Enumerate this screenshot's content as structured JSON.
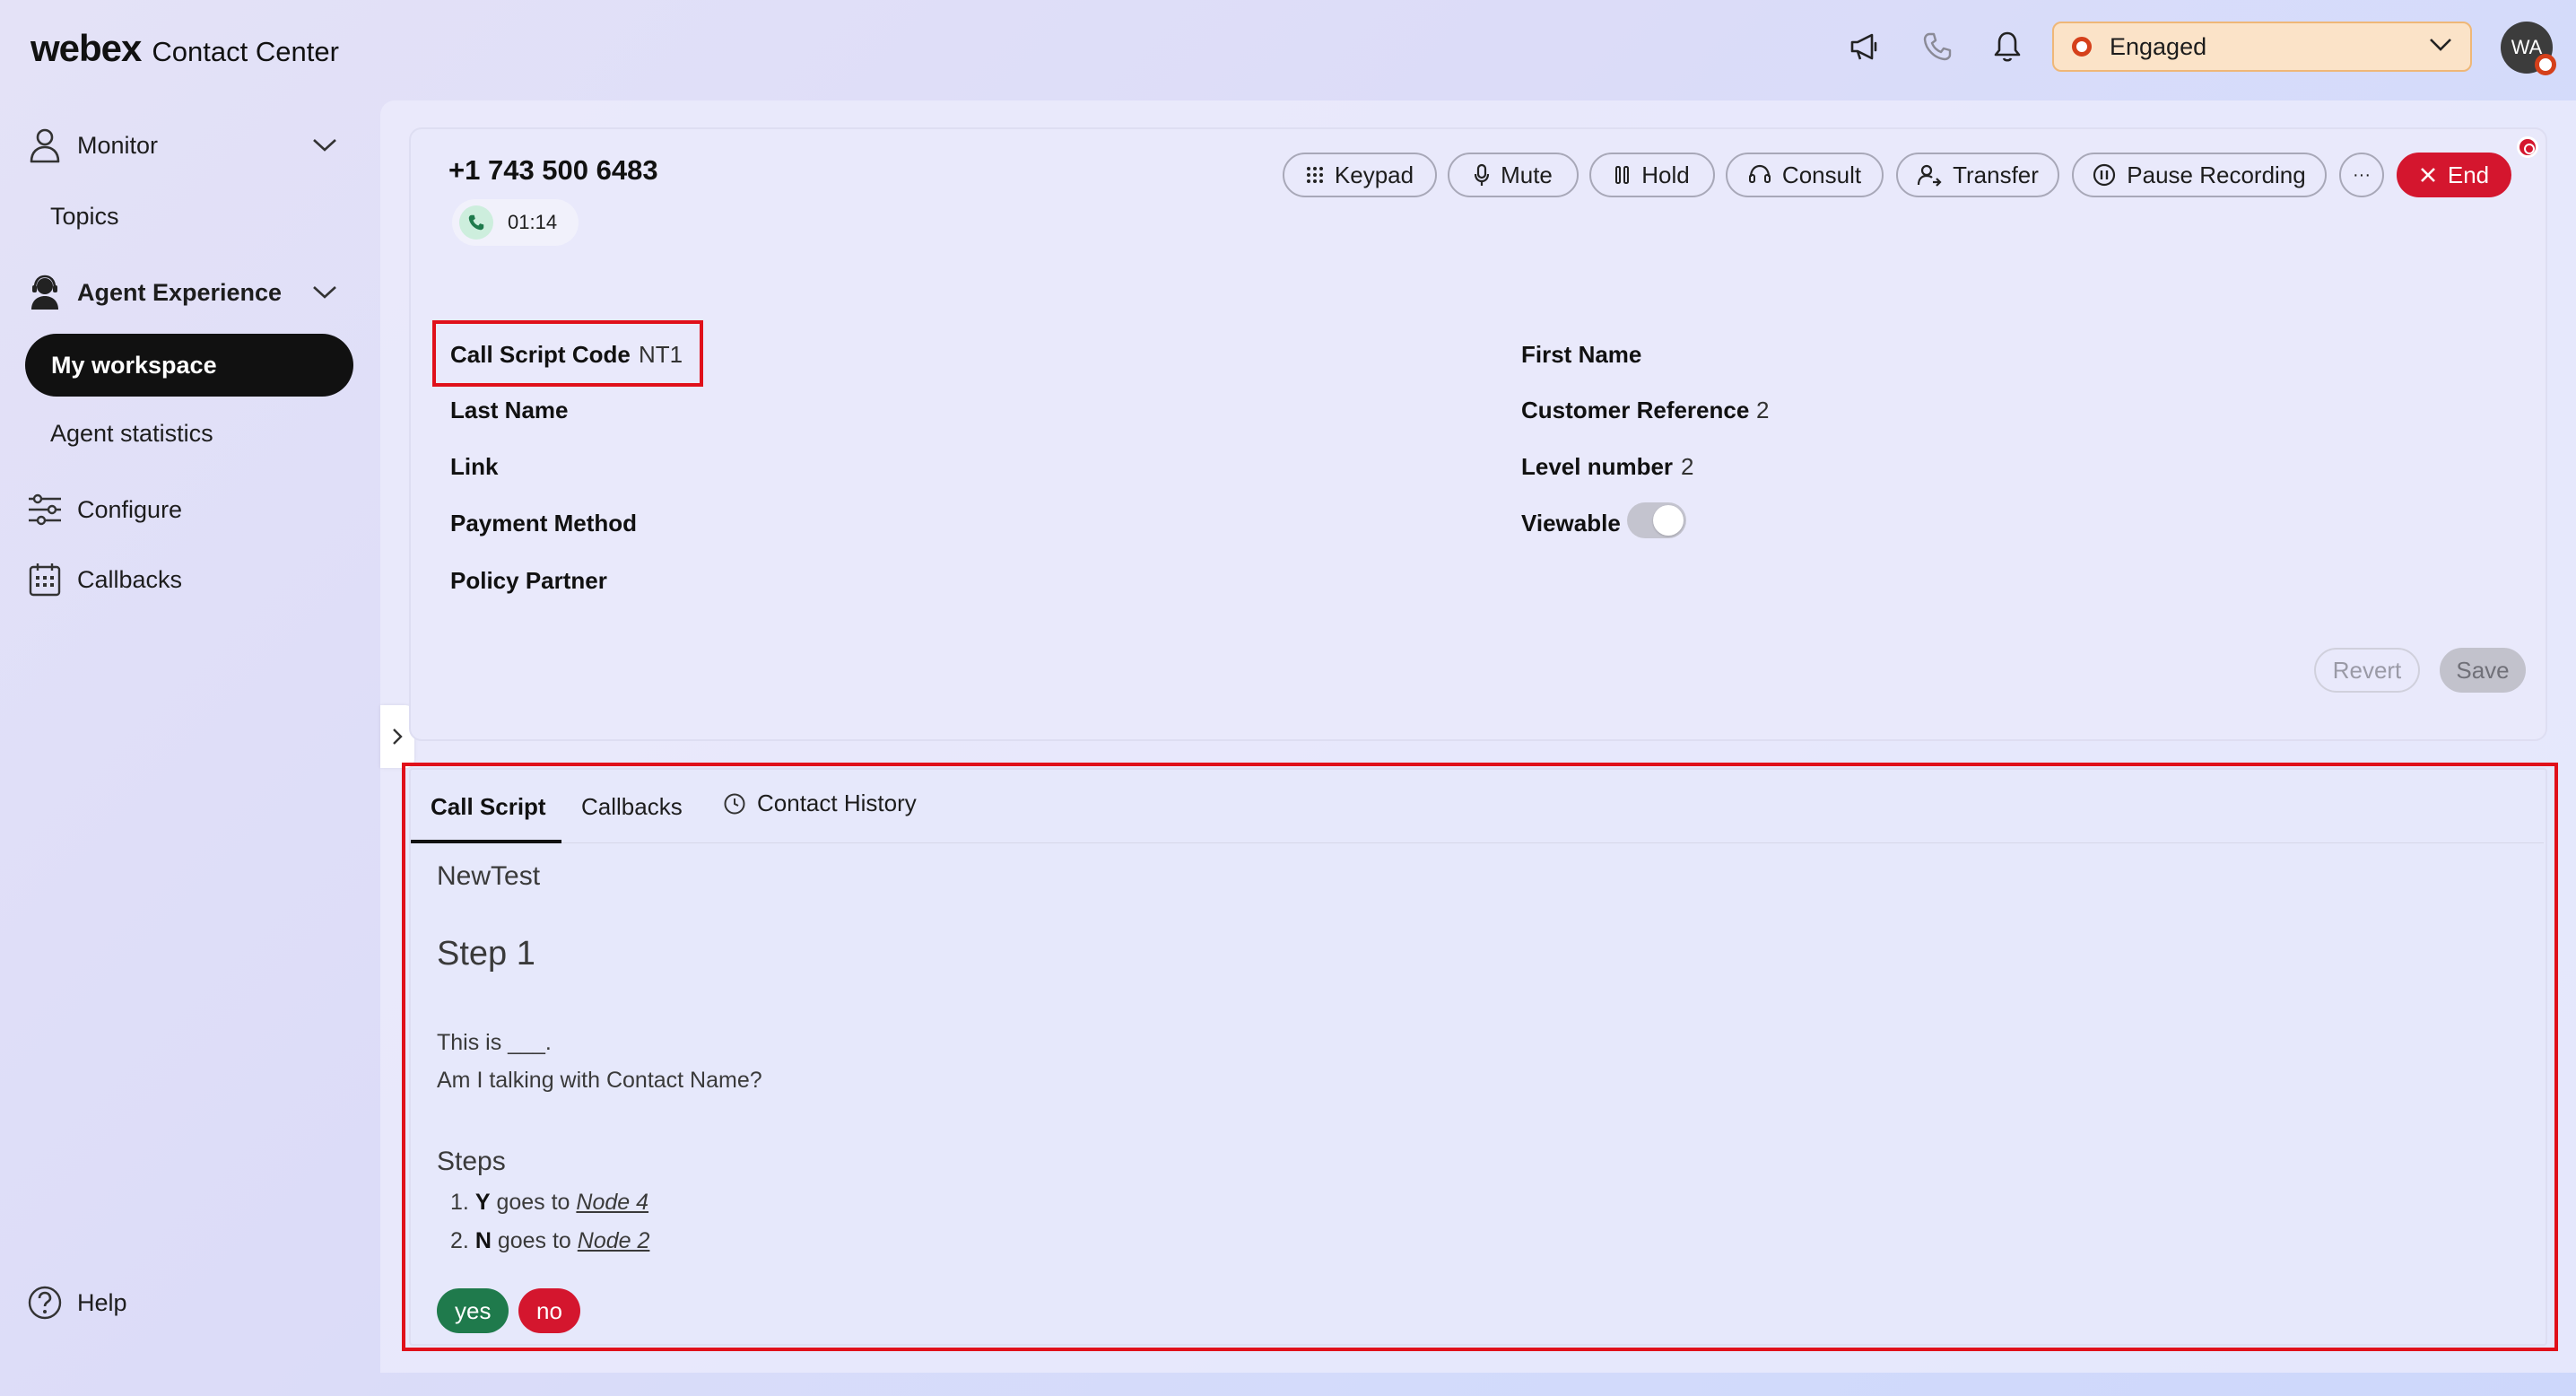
{
  "header": {
    "brand": "webex",
    "product": "Contact Center",
    "state": {
      "label": "Engaged",
      "color": "#d5401b"
    },
    "avatar_initials": "WA",
    "icons": [
      "megaphone-icon",
      "phone-icon",
      "bell-icon"
    ]
  },
  "sidebar": {
    "monitor": "Monitor",
    "topics": "Topics",
    "agent_experience": "Agent Experience",
    "my_workspace": "My workspace",
    "agent_statistics": "Agent statistics",
    "configure": "Configure",
    "callbacks": "Callbacks",
    "help": "Help"
  },
  "call": {
    "phone_number": "+1 743 500 6483",
    "timer": "01:14",
    "controls": {
      "keypad": "Keypad",
      "mute": "Mute",
      "hold": "Hold",
      "consult": "Consult",
      "transfer": "Transfer",
      "pause_recording": "Pause Recording",
      "more": "···",
      "end": "End"
    }
  },
  "fields": {
    "call_script_code": {
      "label": "Call Script Code",
      "value": "NT1"
    },
    "last_name": {
      "label": "Last Name",
      "value": ""
    },
    "link": {
      "label": "Link",
      "value": ""
    },
    "payment_method": {
      "label": "Payment Method",
      "value": ""
    },
    "policy_partner": {
      "label": "Policy Partner",
      "value": ""
    },
    "first_name": {
      "label": "First Name",
      "value": ""
    },
    "customer_reference": {
      "label": "Customer Reference",
      "value": "2"
    },
    "level_number": {
      "label": "Level number",
      "value": "2"
    },
    "viewable": {
      "label": "Viewable",
      "checked": false
    }
  },
  "form_actions": {
    "revert": "Revert",
    "save": "Save"
  },
  "tabs": {
    "call_script": "Call Script",
    "callbacks": "Callbacks",
    "contact_history": "Contact History"
  },
  "script": {
    "title": "NewTest",
    "step_title": "Step 1",
    "line1": "This is ___.",
    "line2": "Am I talking with Contact Name?",
    "steps_heading": "Steps",
    "steps": [
      {
        "num": "1.",
        "key": "Y",
        "text": " goes to ",
        "target": "Node 4"
      },
      {
        "num": "2.",
        "key": "N",
        "text": " goes to ",
        "target": "Node 2"
      }
    ],
    "yes": {
      "label": "yes",
      "color": "#1f7a4c"
    },
    "no": {
      "label": "no",
      "color": "#d4162e"
    }
  }
}
